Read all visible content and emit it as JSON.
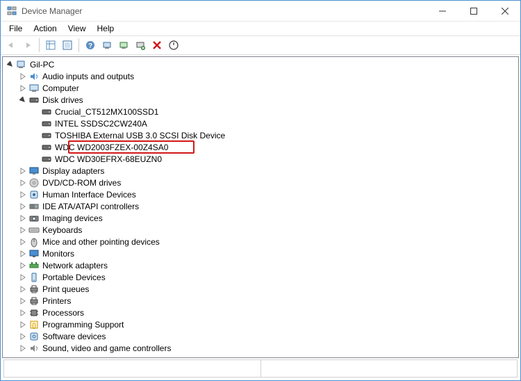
{
  "window": {
    "title": "Device Manager"
  },
  "menu": {
    "file": "File",
    "action": "Action",
    "view": "View",
    "help": "Help"
  },
  "tree": {
    "root": "Gil-PC",
    "categories": [
      {
        "name": "Audio inputs and outputs",
        "icon": "audio",
        "expanded": false
      },
      {
        "name": "Computer",
        "icon": "computer",
        "expanded": false
      },
      {
        "name": "Disk drives",
        "icon": "disk",
        "expanded": true,
        "children": [
          {
            "name": "Crucial_CT512MX100SSD1",
            "icon": "disk",
            "highlight": false
          },
          {
            "name": "INTEL SSDSC2CW240A",
            "icon": "disk",
            "highlight": false
          },
          {
            "name": "TOSHIBA External USB 3.0 SCSI Disk Device",
            "icon": "disk",
            "highlight": false
          },
          {
            "name": "WDC WD2003FZEX-00Z4SA0",
            "icon": "disk",
            "highlight": true
          },
          {
            "name": "WDC WD30EFRX-68EUZN0",
            "icon": "disk",
            "highlight": false
          }
        ]
      },
      {
        "name": "Display adapters",
        "icon": "display",
        "expanded": false
      },
      {
        "name": "DVD/CD-ROM drives",
        "icon": "dvd",
        "expanded": false
      },
      {
        "name": "Human Interface Devices",
        "icon": "hid",
        "expanded": false
      },
      {
        "name": "IDE ATA/ATAPI controllers",
        "icon": "ide",
        "expanded": false
      },
      {
        "name": "Imaging devices",
        "icon": "imaging",
        "expanded": false
      },
      {
        "name": "Keyboards",
        "icon": "keyboard",
        "expanded": false
      },
      {
        "name": "Mice and other pointing devices",
        "icon": "mouse",
        "expanded": false
      },
      {
        "name": "Monitors",
        "icon": "monitor",
        "expanded": false
      },
      {
        "name": "Network adapters",
        "icon": "network",
        "expanded": false
      },
      {
        "name": "Portable Devices",
        "icon": "portable",
        "expanded": false
      },
      {
        "name": "Print queues",
        "icon": "printer",
        "expanded": false
      },
      {
        "name": "Printers",
        "icon": "printer",
        "expanded": false
      },
      {
        "name": "Processors",
        "icon": "cpu",
        "expanded": false
      },
      {
        "name": "Programming Support",
        "icon": "programming",
        "expanded": false
      },
      {
        "name": "Software devices",
        "icon": "software",
        "expanded": false
      },
      {
        "name": "Sound, video and game controllers",
        "icon": "sound",
        "expanded": false
      }
    ]
  }
}
